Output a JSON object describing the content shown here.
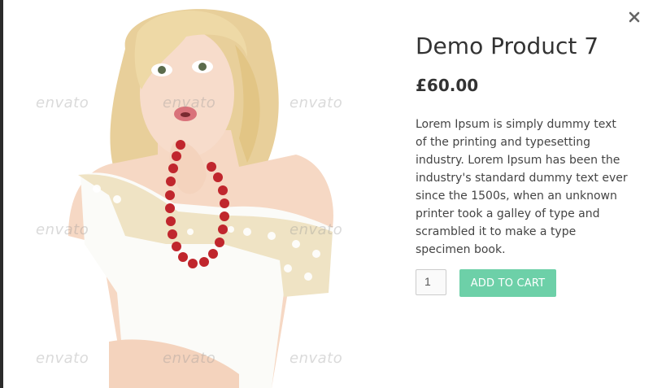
{
  "product": {
    "title": "Demo Product 7",
    "price": "£60.00",
    "description": "Lorem Ipsum is simply dummy text of the printing and typesetting industry. Lorem Ipsum has been the industry's standard dummy text ever since the 1500s, when an unknown printer took a galley of type and scrambled it to make a type specimen book.",
    "quantity": "1",
    "add_to_cart_label": "ADD TO CART"
  },
  "watermark_text": "envato",
  "icons": {
    "close": "close-icon"
  },
  "colors": {
    "accent": "#6dd0a8",
    "title": "#333333",
    "backdrop": "#2b2b2b",
    "necklace": "#c0262d"
  }
}
